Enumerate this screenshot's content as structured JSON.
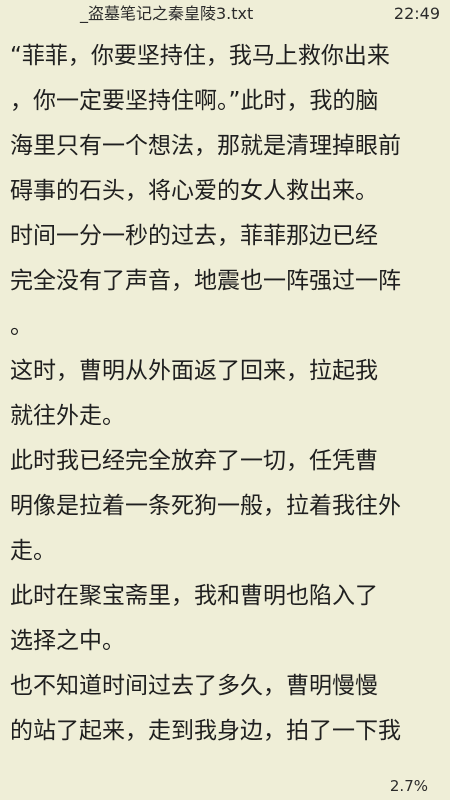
{
  "status_bar": {
    "file_title": "_盗墓笔记之秦皇陵3.txt",
    "time": "22:49"
  },
  "reader": {
    "lines": [
      " “菲菲，你要坚持住，我马上救你出来",
      "，你一定要坚持住啊。”此时，我的脑",
      "海里只有一个想法，那就是清理掉眼前",
      "碍事的石头，将心爱的女人救出来。",
      "  时间一分一秒的过去，菲菲那边已经",
      "完全没有了声音，地震也一阵强过一阵",
      "。",
      "  这时，曹明从外面返了回来，拉起我",
      "就往外走。",
      "  此时我已经完全放弃了一切，任凭曹",
      "明像是拉着一条死狗一般，拉着我往外",
      "走。",
      "  此时在聚宝斋里，我和曹明也陷入了",
      "选择之中。",
      "  也不知道时间过去了多久，曹明慢慢",
      "的站了起来，走到我身边，拍了一下我"
    ]
  },
  "footer": {
    "progress": "2.7%"
  }
}
